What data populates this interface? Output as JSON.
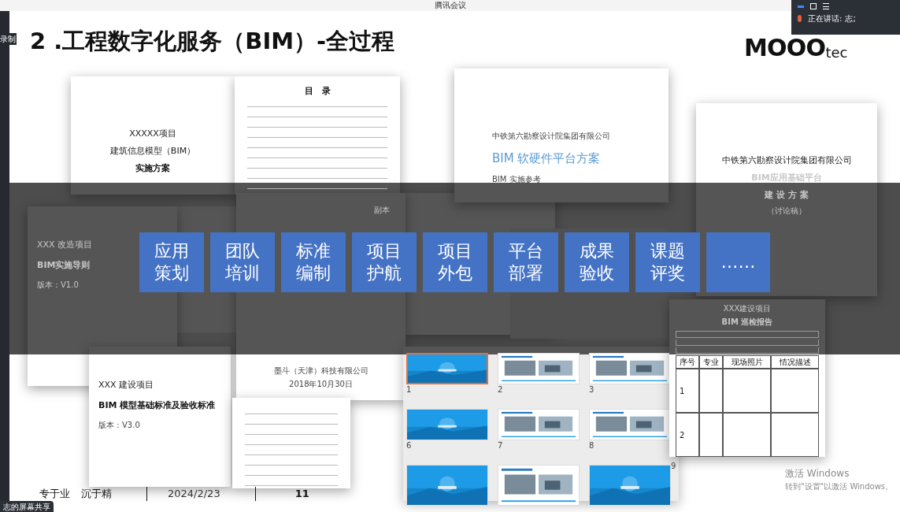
{
  "window": {
    "title": "腾讯会议"
  },
  "recording": {
    "label": "录制"
  },
  "speaker": {
    "label": "正在讲话:",
    "name": "志;"
  },
  "share_label": "志的屏幕共享",
  "slide": {
    "title": "2 .工程数字化服务（BIM）-全过程",
    "logo": {
      "main": "MOOO",
      "suffix": "tec"
    },
    "documents": [
      {
        "kind": "cover",
        "lines": [
          "XXXXX项目",
          "建筑信息模型（BIM）",
          "实施方案"
        ]
      },
      {
        "kind": "toc",
        "lines": [
          "目　录"
        ]
      },
      {
        "kind": "accent",
        "lines": [
          "中铁第六勘察设计院集团有限公司",
          "BIM 软硬件平台方案",
          "BIM 实施参考"
        ]
      },
      {
        "kind": "cover",
        "lines": [
          "中铁第六勘察设计院集团有限公司",
          "BIM应用基础平台",
          "建 设 方 案",
          "（讨论稿）"
        ]
      },
      {
        "kind": "left",
        "lines": [
          "XXX 改造项目",
          "BIM实施导则",
          "版本：V1.0"
        ]
      },
      {
        "kind": "left",
        "lines": [
          "XXX 建设项目",
          "BIM 模型基础标准及验收标准",
          "版本：V3.0"
        ]
      },
      {
        "kind": "imprint",
        "lines": [
          "副本",
          "墨斗（天津）科技有限公司",
          "2018年10月30日"
        ]
      },
      {
        "kind": "toc"
      }
    ],
    "report": {
      "lines": [
        "XXX建设项目",
        "BIM 巡检报告"
      ],
      "columns": [
        "序号",
        "专业",
        "现场照片",
        "情况描述"
      ],
      "rows": [
        "1",
        "2"
      ]
    },
    "thumbnails": [
      {
        "kind": "blue",
        "number": "1",
        "selected": true
      },
      {
        "kind": "white",
        "number": "2",
        "selected": false
      },
      {
        "kind": "white",
        "number": "3",
        "selected": false
      },
      {
        "kind": "blue",
        "number": "6",
        "selected": false
      },
      {
        "kind": "white",
        "number": "7",
        "selected": false
      },
      {
        "kind": "white",
        "number": "8",
        "selected": false
      },
      {
        "kind": "blue",
        "selected": false
      },
      {
        "kind": "white",
        "selected": false
      },
      {
        "kind": "blue",
        "selected": false
      }
    ],
    "extra_number": "9",
    "services": [
      {
        "lines": [
          "应用",
          "策划"
        ]
      },
      {
        "lines": [
          "团队",
          "培训"
        ]
      },
      {
        "lines": [
          "标准",
          "编制"
        ]
      },
      {
        "lines": [
          "项目",
          "护航"
        ]
      },
      {
        "lines": [
          "项目",
          "外包"
        ]
      },
      {
        "lines": [
          "平台",
          "部署"
        ]
      },
      {
        "lines": [
          "成果",
          "验收"
        ]
      },
      {
        "lines": [
          "课题",
          "评奖"
        ]
      },
      {
        "lines": [
          "……"
        ]
      }
    ],
    "footer": {
      "motto": [
        "专于业",
        "沉于精"
      ],
      "date": "2024/2/23",
      "page": "11"
    }
  },
  "activation": {
    "title": "激活 Windows",
    "hint": "转到\"设置\"以激活 Windows。"
  }
}
